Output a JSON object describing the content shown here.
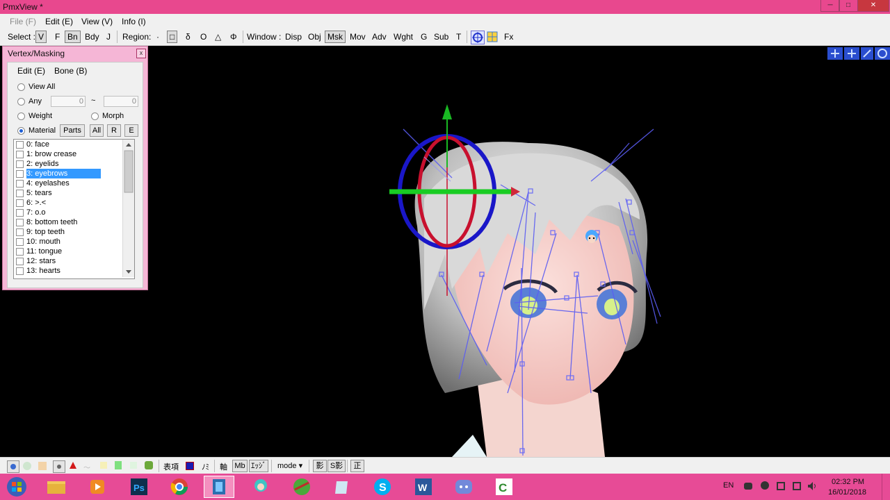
{
  "window": {
    "title": "PmxView *",
    "controls": [
      "─",
      "□",
      "✕"
    ]
  },
  "menu": {
    "items": [
      "File (F)",
      "Edit (E)",
      "View (V)",
      "Info (I)"
    ]
  },
  "toolbar": {
    "select_label": "Select :",
    "select_opts": [
      "V",
      "F",
      "Bn",
      "Bdy",
      "J"
    ],
    "region_label": "Region:",
    "region_opts": [
      "·",
      "□",
      "δ",
      "O",
      "△",
      "Φ"
    ],
    "window_label": "Window :",
    "window_opts": [
      "Disp",
      "Obj",
      "Msk",
      "Mov",
      "Adv",
      "Wght",
      "G",
      "Sub",
      "T"
    ],
    "fx_label": "Fx"
  },
  "panel": {
    "title": "Vertex/Masking",
    "close": "x",
    "menu": [
      "Edit (E)",
      "Bone (B)"
    ],
    "view_all": "View All",
    "any": "Any",
    "any_from": "0",
    "tilde": "~",
    "any_to": "0",
    "weight": "Weight",
    "morph": "Morph",
    "material": "Material",
    "parts_btn": "Parts",
    "all_btn": "All",
    "r_btn": "R",
    "e_btn": "E",
    "selected_mode": "Material",
    "materials": [
      "0: face",
      "1: brow crease",
      "2: eyelids",
      "3: eyebrows",
      "4: eyelashes",
      "5: tears",
      "6: >.<",
      "7: o.o",
      "8: bottom teeth",
      "9: top teeth",
      "10: mouth",
      "11: tongue",
      "12: stars",
      "13: hearts"
    ],
    "selected_material": "3: eyebrows"
  },
  "bottom": {
    "expr_label": "表項",
    "nomi_label": "ﾉﾐ",
    "axis_label": "軸",
    "mb_label": "Mb",
    "edge_label": "ｴｯｼﾞ",
    "mode_label": "mode ▾",
    "shadow_btn": "影",
    "sshadow_btn": "S影",
    "front_btn": "正"
  },
  "tray": {
    "lang": "EN",
    "time": "02:32 PM",
    "date": "16/01/2018"
  },
  "colors": {
    "titlebar": "#e8488e",
    "taskbar": "#e74b96",
    "panel_frame": "#f5b6d6",
    "selection": "#3399ff",
    "bone_lines": "#5a5cf2"
  },
  "icons": [
    "windows-start-icon",
    "file-explorer-icon",
    "media-player-icon",
    "photoshop-icon",
    "chrome-icon",
    "pmx-editor-icon",
    "miku-icon",
    "green-app-icon",
    "notes-icon",
    "skype-icon",
    "word-icon",
    "discord-icon",
    "camtasia-icon"
  ]
}
